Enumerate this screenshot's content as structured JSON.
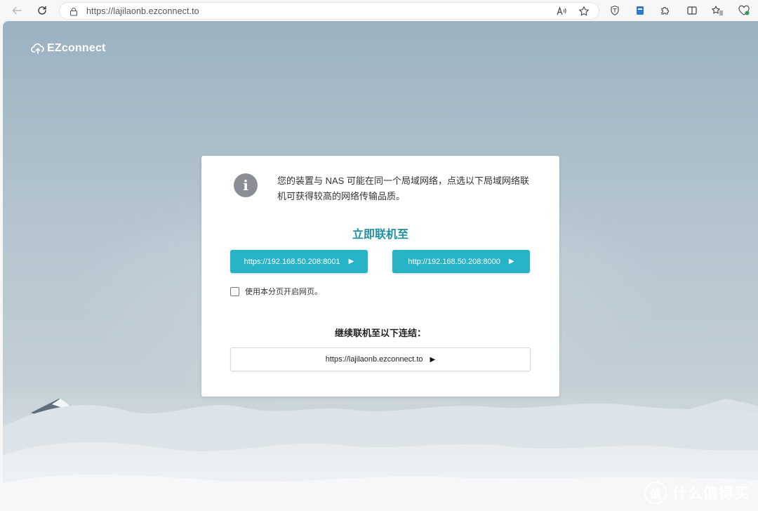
{
  "browser": {
    "url": "https://lajilaonb.ezconnect.to",
    "read_aloud_glyph": "A̅"
  },
  "brand": {
    "name": "EZconnect"
  },
  "dialog": {
    "info_text": "您的装置与 NAS 可能在同一个局域网络，点选以下局域网络联机可获得较高的网络传输品质。",
    "connect_title": "立即联机至",
    "lan_buttons": [
      {
        "label": "https://192.168.50.208:8001"
      },
      {
        "label": "http://192.168.50.208:8000"
      }
    ],
    "open_new_tab_label": "使用本分页开启网页。",
    "continue_title": "继续联机至以下连结：",
    "remote_link": "https://lajilaonb.ezconnect.to"
  },
  "watermark": {
    "logo": "值",
    "text": "什么值得买"
  },
  "colors": {
    "accent": "#26b3c6",
    "title_teal": "#1f8fa3",
    "info_icon": "#8a8e94"
  }
}
